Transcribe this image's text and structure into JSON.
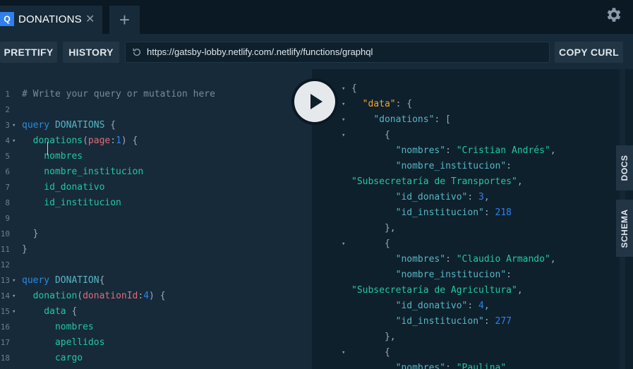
{
  "tabs": [
    {
      "badge": "Q",
      "title": "DONATIONS",
      "close": "✕"
    }
  ],
  "add_tab": "+",
  "toolbar": {
    "prettify": "PRETTIFY",
    "history": "HISTORY",
    "url": "https://gatsby-lobby.netlify.com/.netlify/functions/graphql",
    "copy_curl": "COPY CURL"
  },
  "side_tabs": {
    "docs": "DOCS",
    "schema": "SCHEMA"
  },
  "editor": {
    "lines": [
      {
        "n": "1",
        "fold": false,
        "tokens": [
          {
            "t": "# Write your query or mutation here",
            "c": "c-comment"
          }
        ]
      },
      {
        "n": "2",
        "fold": false,
        "tokens": []
      },
      {
        "n": "3",
        "fold": true,
        "tokens": [
          {
            "t": "query ",
            "c": "c-kw"
          },
          {
            "t": "DONATIONS",
            "c": "c-def"
          },
          {
            "t": " {",
            "c": "c-punc"
          }
        ]
      },
      {
        "n": "4",
        "fold": true,
        "tokens": [
          {
            "t": "  donations",
            "c": "c-field"
          },
          {
            "t": "(",
            "c": "c-punc"
          },
          {
            "t": "page",
            "c": "c-arg"
          },
          {
            "t": ":",
            "c": "c-punc"
          },
          {
            "t": "1",
            "c": "c-num"
          },
          {
            "t": ") {",
            "c": "c-punc"
          }
        ]
      },
      {
        "n": "5",
        "fold": false,
        "tokens": [
          {
            "t": "    nombres",
            "c": "c-field"
          }
        ]
      },
      {
        "n": "6",
        "fold": false,
        "tokens": [
          {
            "t": "    nombre_institucion",
            "c": "c-field"
          }
        ]
      },
      {
        "n": "7",
        "fold": false,
        "tokens": [
          {
            "t": "    id_donativo",
            "c": "c-field"
          }
        ]
      },
      {
        "n": "8",
        "fold": false,
        "tokens": [
          {
            "t": "    id_institucion",
            "c": "c-field"
          }
        ]
      },
      {
        "n": "9",
        "fold": false,
        "tokens": []
      },
      {
        "n": "10",
        "fold": false,
        "tokens": [
          {
            "t": "  }",
            "c": "c-punc"
          }
        ]
      },
      {
        "n": "11",
        "fold": false,
        "tokens": [
          {
            "t": "}",
            "c": "c-punc"
          }
        ]
      },
      {
        "n": "12",
        "fold": false,
        "tokens": []
      },
      {
        "n": "13",
        "fold": true,
        "tokens": [
          {
            "t": "query ",
            "c": "c-kw"
          },
          {
            "t": "DONATION",
            "c": "c-def"
          },
          {
            "t": "{",
            "c": "c-punc"
          }
        ]
      },
      {
        "n": "14",
        "fold": true,
        "tokens": [
          {
            "t": "  donation",
            "c": "c-field"
          },
          {
            "t": "(",
            "c": "c-punc"
          },
          {
            "t": "donationId",
            "c": "c-arg"
          },
          {
            "t": ":",
            "c": "c-punc"
          },
          {
            "t": "4",
            "c": "c-num"
          },
          {
            "t": ") {",
            "c": "c-punc"
          }
        ]
      },
      {
        "n": "15",
        "fold": true,
        "tokens": [
          {
            "t": "    data",
            "c": "c-field"
          },
          {
            "t": " {",
            "c": "c-punc"
          }
        ]
      },
      {
        "n": "16",
        "fold": false,
        "tokens": [
          {
            "t": "      nombres",
            "c": "c-field"
          }
        ]
      },
      {
        "n": "17",
        "fold": false,
        "tokens": [
          {
            "t": "      apellidos",
            "c": "c-field"
          }
        ]
      },
      {
        "n": "18",
        "fold": false,
        "tokens": [
          {
            "t": "      cargo",
            "c": "c-field"
          }
        ]
      }
    ]
  },
  "result": {
    "lines": [
      {
        "fold": true,
        "tokens": [
          {
            "t": "{",
            "c": "c-punc"
          }
        ]
      },
      {
        "fold": true,
        "tokens": [
          {
            "t": "  ",
            "c": "c-punc"
          },
          {
            "t": "\"data\"",
            "c": "r-data"
          },
          {
            "t": ": {",
            "c": "c-punc"
          }
        ]
      },
      {
        "fold": true,
        "tokens": [
          {
            "t": "    ",
            "c": "c-punc"
          },
          {
            "t": "\"donations\"",
            "c": "r-key"
          },
          {
            "t": ": [",
            "c": "c-punc"
          }
        ]
      },
      {
        "fold": true,
        "tokens": [
          {
            "t": "      {",
            "c": "c-punc"
          }
        ]
      },
      {
        "fold": false,
        "tokens": [
          {
            "t": "        ",
            "c": "c-punc"
          },
          {
            "t": "\"nombres\"",
            "c": "r-key"
          },
          {
            "t": ": ",
            "c": "c-punc"
          },
          {
            "t": "\"Cristian Andrés\"",
            "c": "r-str"
          },
          {
            "t": ",",
            "c": "c-punc"
          }
        ]
      },
      {
        "fold": false,
        "tokens": [
          {
            "t": "        ",
            "c": "c-punc"
          },
          {
            "t": "\"nombre_institucion\"",
            "c": "r-key"
          },
          {
            "t": ":",
            "c": "c-punc"
          }
        ]
      },
      {
        "fold": false,
        "tokens": [
          {
            "t": "\"Subsecretaría de Transportes\"",
            "c": "r-str"
          },
          {
            "t": ",",
            "c": "c-punc"
          }
        ]
      },
      {
        "fold": false,
        "tokens": [
          {
            "t": "        ",
            "c": "c-punc"
          },
          {
            "t": "\"id_donativo\"",
            "c": "r-key"
          },
          {
            "t": ": ",
            "c": "c-punc"
          },
          {
            "t": "3",
            "c": "r-num"
          },
          {
            "t": ",",
            "c": "c-punc"
          }
        ]
      },
      {
        "fold": false,
        "tokens": [
          {
            "t": "        ",
            "c": "c-punc"
          },
          {
            "t": "\"id_institucion\"",
            "c": "r-key"
          },
          {
            "t": ": ",
            "c": "c-punc"
          },
          {
            "t": "218",
            "c": "r-num"
          }
        ]
      },
      {
        "fold": false,
        "tokens": [
          {
            "t": "      },",
            "c": "c-punc"
          }
        ]
      },
      {
        "fold": true,
        "tokens": [
          {
            "t": "      {",
            "c": "c-punc"
          }
        ]
      },
      {
        "fold": false,
        "tokens": [
          {
            "t": "        ",
            "c": "c-punc"
          },
          {
            "t": "\"nombres\"",
            "c": "r-key"
          },
          {
            "t": ": ",
            "c": "c-punc"
          },
          {
            "t": "\"Claudio Armando\"",
            "c": "r-str"
          },
          {
            "t": ",",
            "c": "c-punc"
          }
        ]
      },
      {
        "fold": false,
        "tokens": [
          {
            "t": "        ",
            "c": "c-punc"
          },
          {
            "t": "\"nombre_institucion\"",
            "c": "r-key"
          },
          {
            "t": ":",
            "c": "c-punc"
          }
        ]
      },
      {
        "fold": false,
        "tokens": [
          {
            "t": "\"Subsecretaría de Agricultura\"",
            "c": "r-str"
          },
          {
            "t": ",",
            "c": "c-punc"
          }
        ]
      },
      {
        "fold": false,
        "tokens": [
          {
            "t": "        ",
            "c": "c-punc"
          },
          {
            "t": "\"id_donativo\"",
            "c": "r-key"
          },
          {
            "t": ": ",
            "c": "c-punc"
          },
          {
            "t": "4",
            "c": "r-num"
          },
          {
            "t": ",",
            "c": "c-punc"
          }
        ]
      },
      {
        "fold": false,
        "tokens": [
          {
            "t": "        ",
            "c": "c-punc"
          },
          {
            "t": "\"id_institucion\"",
            "c": "r-key"
          },
          {
            "t": ": ",
            "c": "c-punc"
          },
          {
            "t": "277",
            "c": "r-num"
          }
        ]
      },
      {
        "fold": false,
        "tokens": [
          {
            "t": "      },",
            "c": "c-punc"
          }
        ]
      },
      {
        "fold": true,
        "tokens": [
          {
            "t": "      {",
            "c": "c-punc"
          }
        ]
      },
      {
        "fold": false,
        "tokens": [
          {
            "t": "        ",
            "c": "c-punc"
          },
          {
            "t": "\"nombres\"",
            "c": "r-key"
          },
          {
            "t": ": ",
            "c": "c-punc"
          },
          {
            "t": "\"Paulina\"",
            "c": "r-str"
          },
          {
            "t": ",",
            "c": "c-punc"
          }
        ]
      }
    ]
  }
}
